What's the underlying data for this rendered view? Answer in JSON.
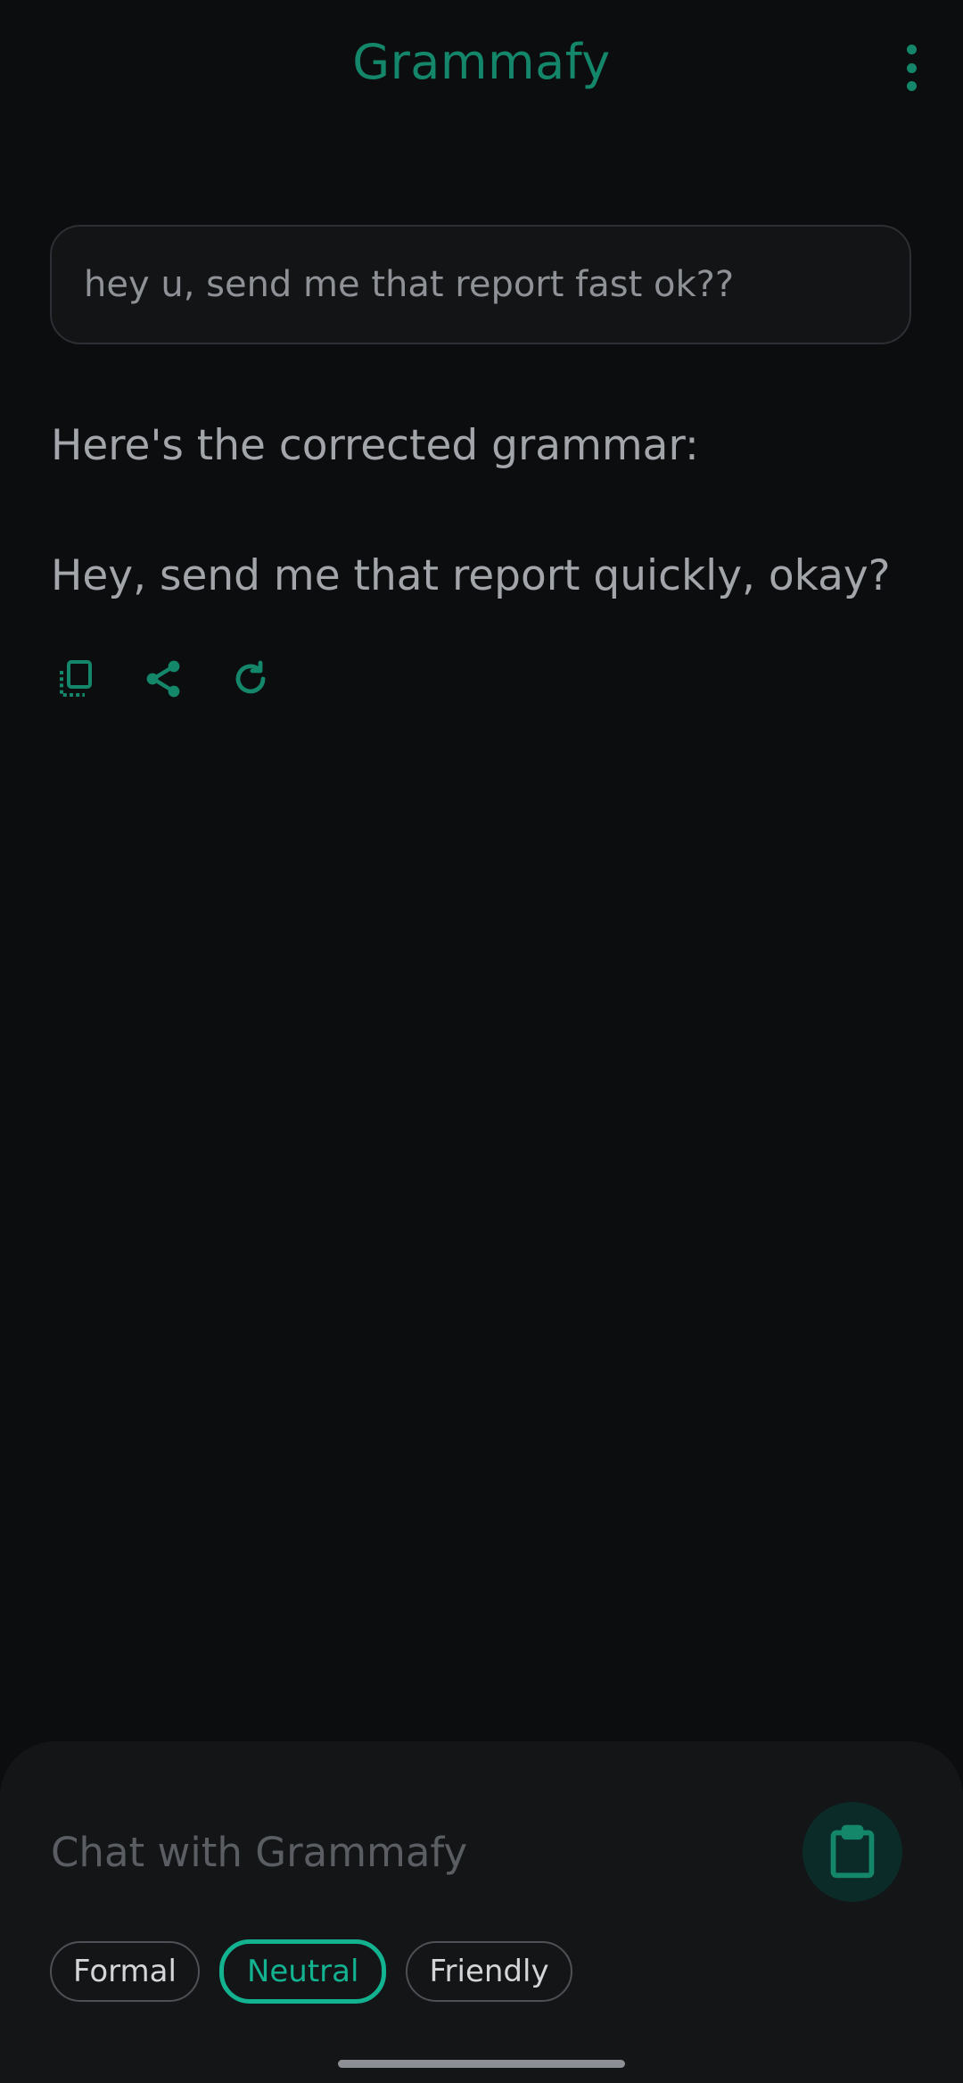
{
  "app": {
    "title": "Grammafy"
  },
  "header": {
    "menu_icon": "more-vert-icon"
  },
  "input": {
    "text": "hey u, send me that report fast ok??"
  },
  "result": {
    "intro": "Here's the corrected grammar:",
    "corrected": "Hey, send me that report quickly, okay?"
  },
  "actions": [
    {
      "icon": "copy-icon"
    },
    {
      "icon": "share-icon"
    },
    {
      "icon": "refresh-icon"
    }
  ],
  "chat": {
    "placeholder": "Chat with Grammafy",
    "paste_icon": "clipboard-icon"
  },
  "tones": {
    "items": [
      "Formal",
      "Neutral",
      "Friendly"
    ],
    "selected": "Neutral"
  },
  "colors": {
    "accent": "#14876a",
    "accent_bright": "#13b290",
    "background": "#0c0d0f",
    "sheet": "#131517"
  }
}
